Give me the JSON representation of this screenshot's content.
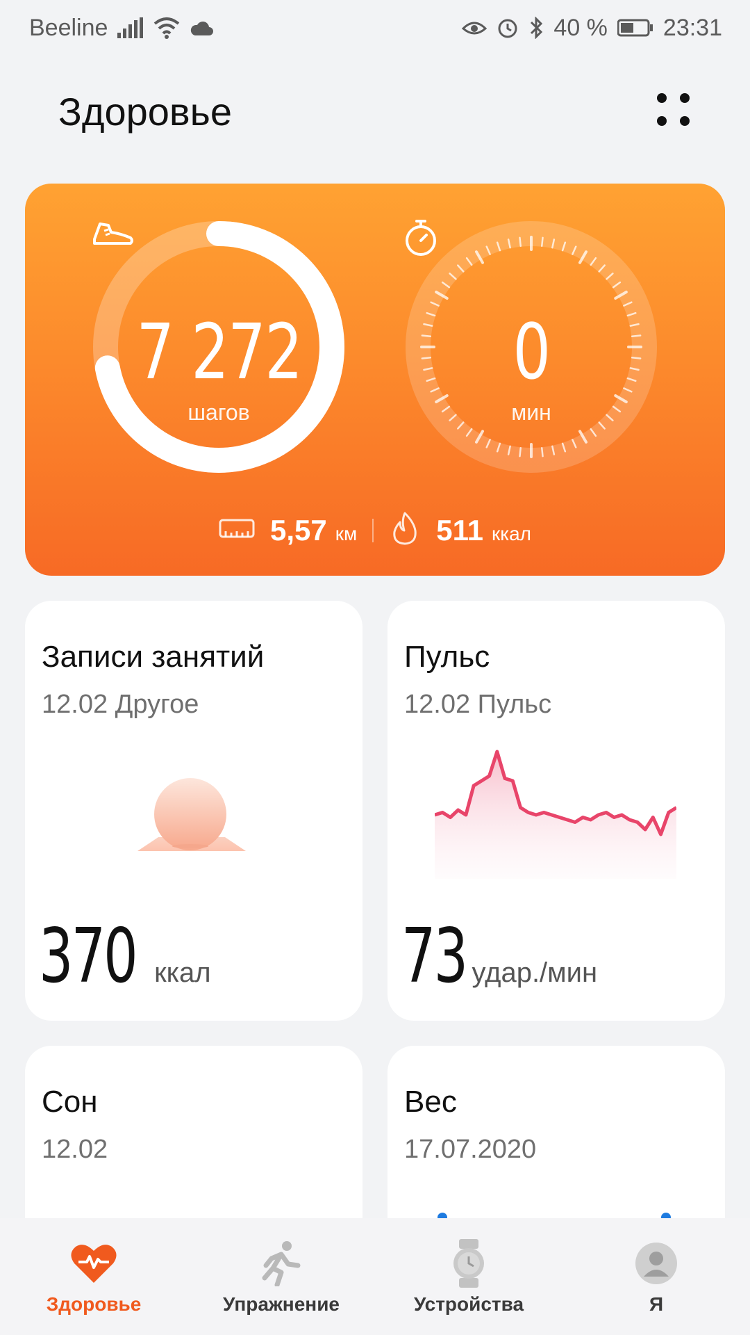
{
  "status_bar": {
    "carrier": "Beeline",
    "battery_percent": "40 %",
    "time": "23:31"
  },
  "header": {
    "title": "Здоровье",
    "menu_icon": "grid-dots-icon"
  },
  "activity_card": {
    "steps": {
      "value": "7 272",
      "unit": "шагов",
      "progress": 0.72,
      "icon": "sneaker-icon"
    },
    "active_minutes": {
      "value": "0",
      "unit": "мин",
      "icon": "stopwatch-icon"
    },
    "distance": {
      "value": "5,57",
      "unit": "км",
      "icon": "ruler-icon"
    },
    "calories": {
      "value": "511",
      "unit": "ккал",
      "icon": "flame-icon"
    },
    "colors": {
      "top": "#ffa232",
      "bottom": "#f76a25"
    }
  },
  "tiles": {
    "workouts": {
      "title": "Записи занятий",
      "subtitle": "12.02 Другое",
      "value": "370",
      "unit": "ккал"
    },
    "pulse": {
      "title": "Пульс",
      "subtitle": "12.02 Пульс",
      "value": "73",
      "unit": "удар./мин"
    },
    "sleep": {
      "title": "Сон",
      "subtitle": "12.02"
    },
    "weight": {
      "title": "Вес",
      "subtitle": "17.07.2020"
    }
  },
  "pulse_chart": {
    "type": "line",
    "color": "#e8456a",
    "values": [
      72,
      73,
      71,
      74,
      72,
      84,
      86,
      88,
      98,
      87,
      86,
      75,
      73,
      72,
      73,
      72,
      71,
      70,
      69,
      71,
      70,
      72,
      73,
      71,
      72,
      70,
      69,
      66,
      71,
      64,
      73,
      75
    ]
  },
  "bottom_nav": {
    "items": [
      {
        "label": "Здоровье",
        "icon": "heart-pulse-icon",
        "active": true
      },
      {
        "label": "Упражнение",
        "icon": "runner-icon",
        "active": false
      },
      {
        "label": "Устройства",
        "icon": "watch-icon",
        "active": false
      },
      {
        "label": "Я",
        "icon": "profile-icon",
        "active": false
      }
    ],
    "active_color": "#f05a1e"
  }
}
